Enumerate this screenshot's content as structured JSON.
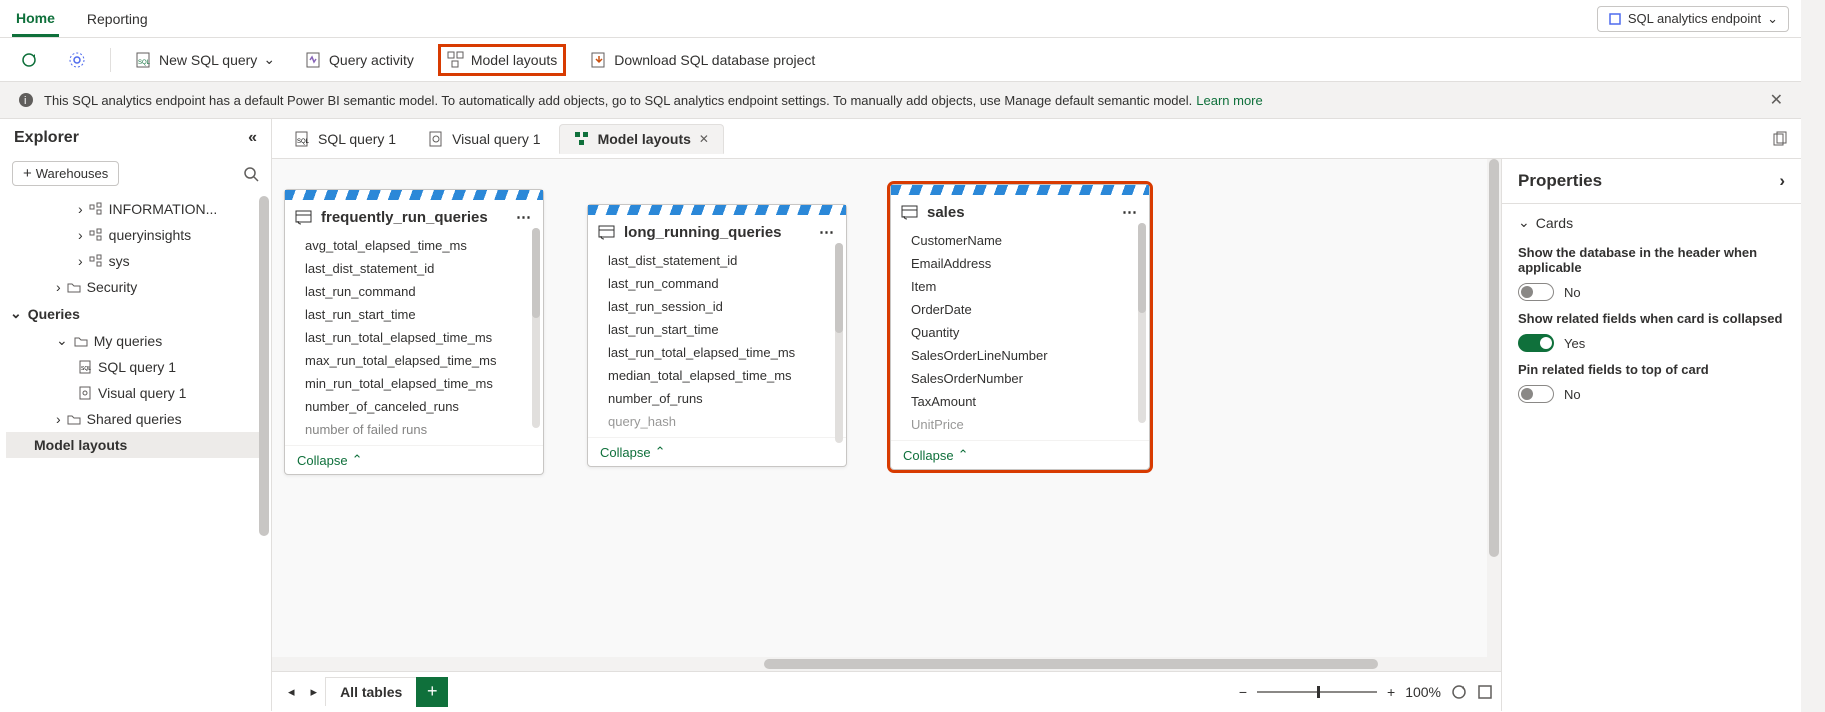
{
  "tabs": {
    "home": "Home",
    "reporting": "Reporting"
  },
  "endpoint": {
    "label": "SQL analytics endpoint"
  },
  "toolbar": {
    "new_sql": "New SQL query",
    "query_activity": "Query activity",
    "model_layouts": "Model layouts",
    "download": "Download SQL database project"
  },
  "info_bar": {
    "text": "This SQL analytics endpoint has a default Power BI semantic model. To automatically add objects, go to SQL analytics endpoint settings. To manually add objects, use Manage default semantic model.",
    "link": "Learn more"
  },
  "explorer": {
    "title": "Explorer",
    "warehouses_btn": "Warehouses",
    "tree": {
      "information": "INFORMATION...",
      "queryinsights": "queryinsights",
      "sys": "sys",
      "security": "Security",
      "queries": "Queries",
      "my_queries": "My queries",
      "sql_q1": "SQL query 1",
      "visual_q1": "Visual query 1",
      "shared_q": "Shared queries",
      "model_layouts": "Model layouts"
    }
  },
  "doc_tabs": {
    "sql_q1": "SQL query 1",
    "visual_q1": "Visual query 1",
    "model_layouts": "Model layouts"
  },
  "cards": {
    "frequently": {
      "title": "frequently_run_queries",
      "fields": [
        "avg_total_elapsed_time_ms",
        "last_dist_statement_id",
        "last_run_command",
        "last_run_start_time",
        "last_run_total_elapsed_time_ms",
        "max_run_total_elapsed_time_ms",
        "min_run_total_elapsed_time_ms",
        "number_of_canceled_runs",
        "number of failed runs"
      ],
      "collapse": "Collapse"
    },
    "long_running": {
      "title": "long_running_queries",
      "fields": [
        "last_dist_statement_id",
        "last_run_command",
        "last_run_session_id",
        "last_run_start_time",
        "last_run_total_elapsed_time_ms",
        "median_total_elapsed_time_ms",
        "number_of_runs",
        "query_hash"
      ],
      "collapse": "Collapse"
    },
    "sales": {
      "title": "sales",
      "fields": [
        "CustomerName",
        "EmailAddress",
        "Item",
        "OrderDate",
        "Quantity",
        "SalesOrderLineNumber",
        "SalesOrderNumber",
        "TaxAmount",
        "UnitPrice"
      ],
      "collapse": "Collapse"
    }
  },
  "properties": {
    "title": "Properties",
    "cards_section": "Cards",
    "opt1_label": "Show the database in the header when applicable",
    "opt1_value": "No",
    "opt2_label": "Show related fields when card is collapsed",
    "opt2_value": "Yes",
    "opt3_label": "Pin related fields to top of card",
    "opt3_value": "No"
  },
  "bottom": {
    "all_tables": "All tables",
    "zoom": "100%"
  }
}
